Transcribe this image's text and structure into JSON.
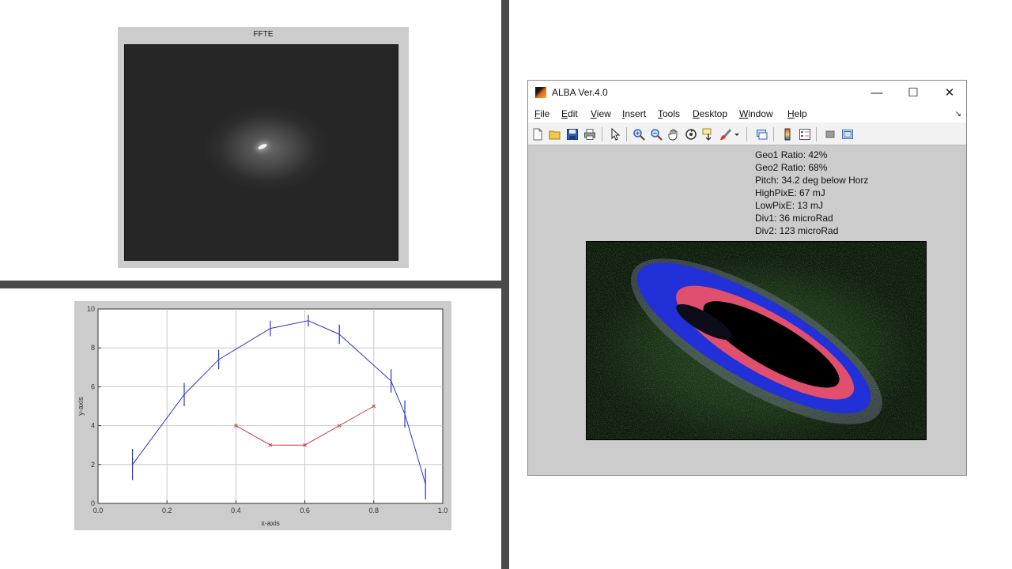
{
  "ffte": {
    "title": "FFTE"
  },
  "chart_data": {
    "type": "line",
    "xlabel": "x-axis",
    "ylabel": "y-axis",
    "xlim": [
      0.0,
      1.0
    ],
    "ylim": [
      0,
      10
    ],
    "x_ticks": [
      "0.0",
      "0.2",
      "0.4",
      "0.6",
      "0.8",
      "1.0"
    ],
    "y_ticks": [
      "0",
      "2",
      "4",
      "6",
      "8",
      "10"
    ],
    "grid": true,
    "series": [
      {
        "color": "#2b35c8",
        "x": [
          0.1,
          0.25,
          0.35,
          0.5,
          0.61,
          0.7,
          0.85,
          0.89,
          0.95
        ],
        "y": [
          2.0,
          5.6,
          7.4,
          9.0,
          9.4,
          8.7,
          6.3,
          4.6,
          1.0
        ],
        "err": [
          0.8,
          0.6,
          0.5,
          0.4,
          0.3,
          0.5,
          0.6,
          0.7,
          0.8
        ]
      },
      {
        "color": "#d23a3a",
        "marker": "x",
        "x": [
          0.4,
          0.5,
          0.6,
          0.7,
          0.8
        ],
        "y": [
          4.0,
          3.0,
          3.0,
          4.0,
          5.0
        ]
      }
    ]
  },
  "alba": {
    "title": "ALBA Ver.4.0",
    "window_controls": {
      "minimize": "—",
      "maximize": "☐",
      "close": "✕"
    },
    "menu": [
      {
        "key": "F",
        "rest": "ile"
      },
      {
        "key": "E",
        "rest": "dit"
      },
      {
        "key": "V",
        "rest": "iew"
      },
      {
        "key": "I",
        "rest": "nsert"
      },
      {
        "key": "T",
        "rest": "ools"
      },
      {
        "key": "D",
        "rest": "esktop"
      },
      {
        "key": "W",
        "rest": "indow"
      },
      {
        "key": "H",
        "rest": "elp"
      }
    ],
    "dock_arrow": "↘",
    "toolbar_icons": [
      "new-file-icon",
      "open-folder-icon",
      "save-icon",
      "print-icon",
      "pointer-icon",
      "zoom-in-icon",
      "zoom-out-icon",
      "pan-hand-icon",
      "rotate-3d-icon",
      "data-cursor-icon",
      "brush-icon",
      "link-plot-icon",
      "colorbar-icon",
      "legend-icon",
      "hide-plot-tools-icon",
      "show-plot-tools-icon"
    ],
    "params": [
      "Geo1 Ratio: 42%",
      "Geo2 Ratio: 68%",
      "Pitch: 34.2 deg below Horz",
      "HighPixE: 67 mJ",
      "LowPixE: 13 mJ",
      "Div1: 36 microRad",
      "Div2: 123 microRad"
    ],
    "colors": {
      "outer_halo": "#2230d8",
      "inner_ring": "#e0506e",
      "core": "#000000",
      "background": "#24401f"
    }
  }
}
